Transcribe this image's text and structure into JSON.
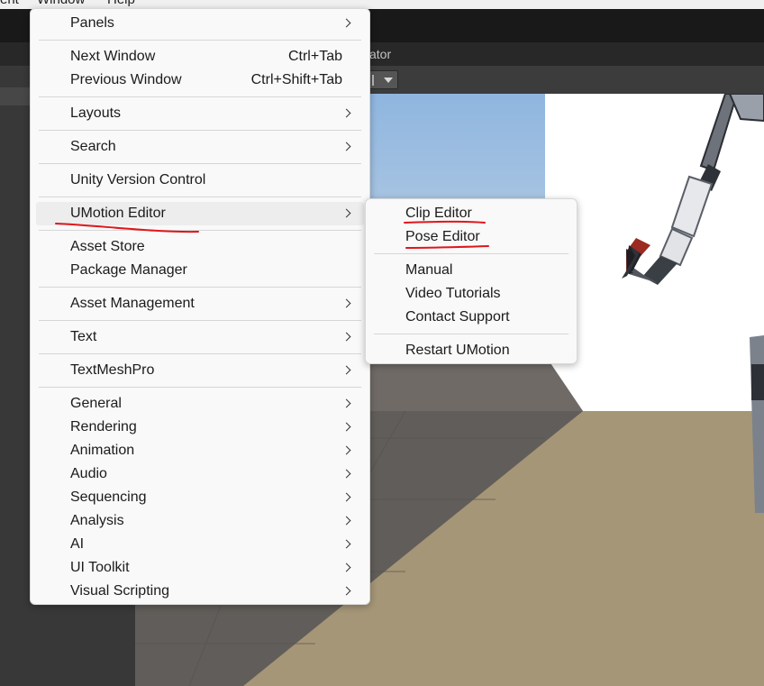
{
  "menubar": {
    "items": [
      "ent",
      "Window",
      "Help"
    ]
  },
  "editor": {
    "tab_fragment": "ator"
  },
  "window_menu": {
    "groups": [
      [
        {
          "label": "Panels",
          "submenu": true
        }
      ],
      [
        {
          "label": "Next Window",
          "shortcut": "Ctrl+Tab"
        },
        {
          "label": "Previous Window",
          "shortcut": "Ctrl+Shift+Tab"
        }
      ],
      [
        {
          "label": "Layouts",
          "submenu": true
        }
      ],
      [
        {
          "label": "Search",
          "submenu": true
        }
      ],
      [
        {
          "label": "Unity Version Control"
        }
      ],
      [
        {
          "label": "UMotion Editor",
          "submenu": true,
          "highlighted": true
        }
      ],
      [
        {
          "label": "Asset Store"
        },
        {
          "label": "Package Manager"
        }
      ],
      [
        {
          "label": "Asset Management",
          "submenu": true
        }
      ],
      [
        {
          "label": "Text",
          "submenu": true
        }
      ],
      [
        {
          "label": "TextMeshPro",
          "submenu": true
        }
      ],
      [
        {
          "label": "General",
          "submenu": true
        },
        {
          "label": "Rendering",
          "submenu": true
        },
        {
          "label": "Animation",
          "submenu": true
        },
        {
          "label": "Audio",
          "submenu": true
        },
        {
          "label": "Sequencing",
          "submenu": true
        },
        {
          "label": "Analysis",
          "submenu": true
        },
        {
          "label": "AI",
          "submenu": true
        },
        {
          "label": "UI Toolkit",
          "submenu": true
        },
        {
          "label": "Visual Scripting",
          "submenu": true
        }
      ]
    ]
  },
  "umotion_submenu": {
    "groups": [
      [
        {
          "label": "Clip Editor"
        },
        {
          "label": "Pose Editor"
        }
      ],
      [
        {
          "label": "Manual"
        },
        {
          "label": "Video Tutorials"
        },
        {
          "label": "Contact Support"
        }
      ],
      [
        {
          "label": "Restart UMotion"
        }
      ]
    ]
  },
  "colors": {
    "annotation": "#e0161b",
    "menu_bg": "#f9f9f9",
    "highlight": "#ededed"
  }
}
